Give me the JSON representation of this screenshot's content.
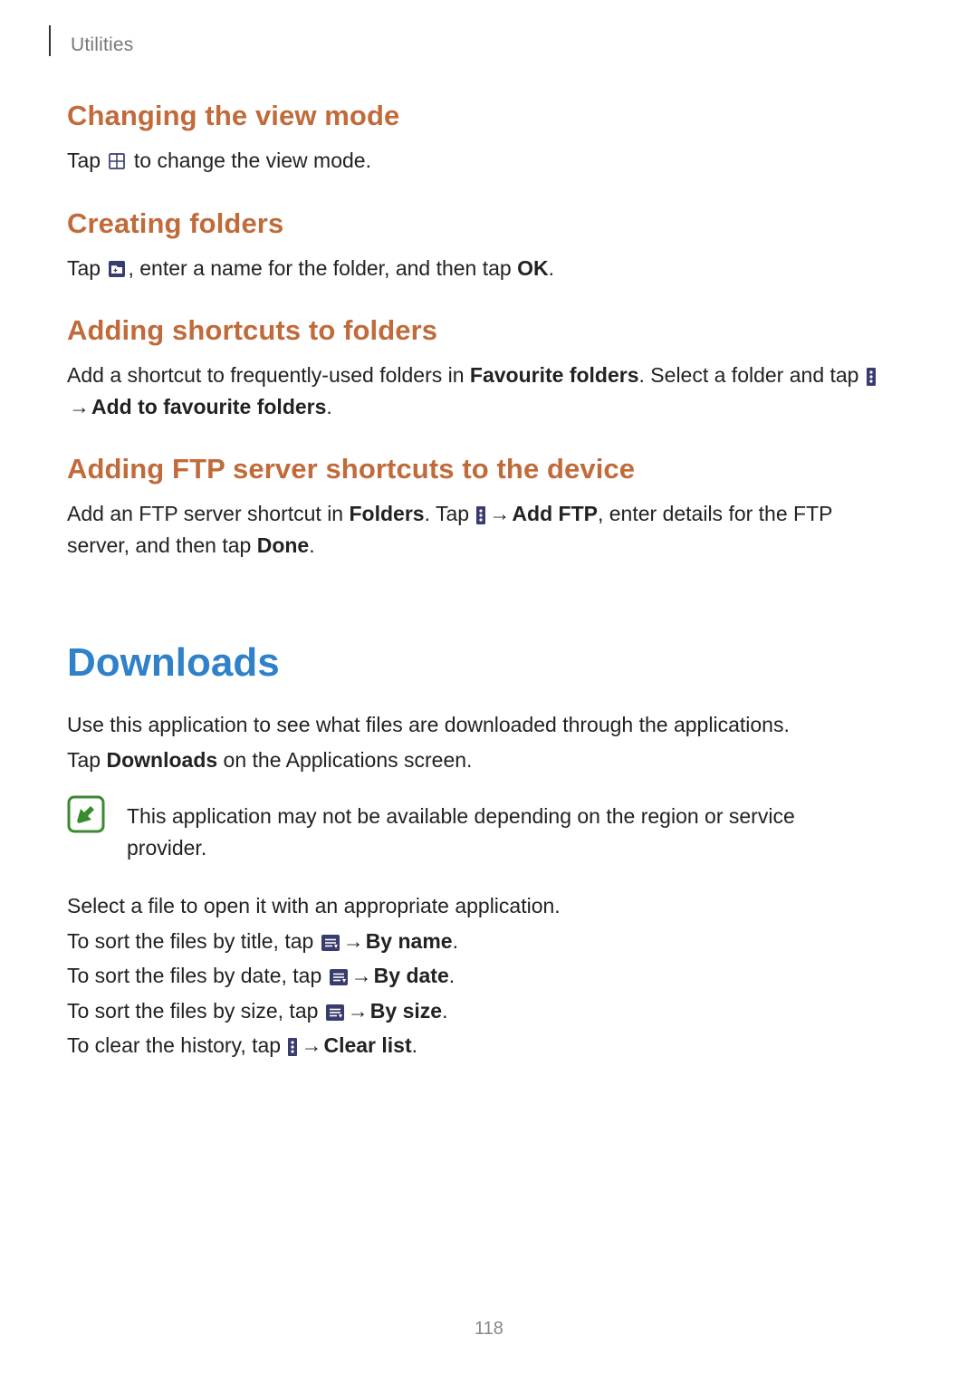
{
  "header": {
    "breadcrumb": "Utilities"
  },
  "sections": {
    "s1": {
      "title": "Changing the view mode",
      "p1a": "Tap ",
      "p1b": " to change the view mode."
    },
    "s2": {
      "title": "Creating folders",
      "p1a": "Tap ",
      "p1b": ", enter a name for the folder, and then tap ",
      "p1c": "OK",
      "p1d": "."
    },
    "s3": {
      "title": "Adding shortcuts to folders",
      "p1a": "Add a shortcut to frequently-used folders in ",
      "p1b": "Favourite folders",
      "p1c": ". Select a folder and tap ",
      "p1d": " → ",
      "p1e": "Add to favourite folders",
      "p1f": "."
    },
    "s4": {
      "title": "Adding FTP server shortcuts to the device",
      "p1a": "Add an FTP server shortcut in ",
      "p1b": "Folders",
      "p1c": ". Tap ",
      "p1d": " → ",
      "p1e": "Add FTP",
      "p1f": ", enter details for the FTP server, and then tap ",
      "p1g": "Done",
      "p1h": "."
    }
  },
  "downloads": {
    "title": "Downloads",
    "intro1": "Use this application to see what files are downloaded through the applications.",
    "intro2a": "Tap ",
    "intro2b": "Downloads",
    "intro2c": " on the Applications screen.",
    "note": "This application may not be available depending on the region or service provider.",
    "p_select": "Select a file to open it with an appropriate application.",
    "sort_title": {
      "a": "To sort the files by title, tap ",
      "b": " → ",
      "c": "By name",
      "d": "."
    },
    "sort_date": {
      "a": "To sort the files by date, tap ",
      "b": " → ",
      "c": "By date",
      "d": "."
    },
    "sort_size": {
      "a": "To sort the files by size, tap ",
      "b": " → ",
      "c": "By size",
      "d": "."
    },
    "clear": {
      "a": "To clear the history, tap ",
      "b": " → ",
      "c": "Clear list",
      "d": "."
    }
  },
  "page_number": "118"
}
